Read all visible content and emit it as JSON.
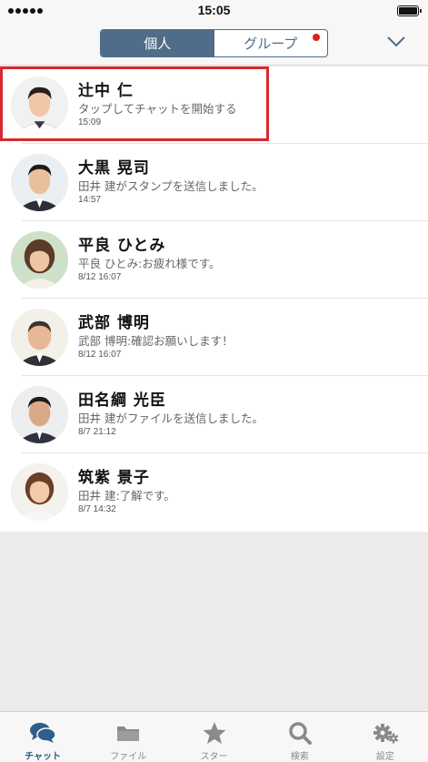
{
  "status_bar": {
    "time": "15:05",
    "battery_level": 1.0
  },
  "header": {
    "segments": [
      {
        "label": "個人",
        "active": true
      },
      {
        "label": "グループ",
        "active": false,
        "badge": true
      }
    ]
  },
  "chats": [
    {
      "name": "辻中 仁",
      "preview": "タップしてチャットを開始する",
      "time": "15:09",
      "highlighted": true
    },
    {
      "name": "大黒 晃司",
      "preview": "田井 建がスタンプを送信しました。",
      "time": "14:57"
    },
    {
      "name": "平良 ひとみ",
      "preview": "平良 ひとみ:お疲れ様です。",
      "time": "8/12 16:07"
    },
    {
      "name": "武部 博明",
      "preview": "武部 博明:確認お願いします！",
      "time": "8/12 16:07"
    },
    {
      "name": "田名綱 光臣",
      "preview": "田井 建がファイルを送信しました。",
      "time": "8/7 21:12"
    },
    {
      "name": "筑紫 景子",
      "preview": "田井 建:了解です。",
      "time": "8/7 14:32"
    }
  ],
  "tabbar": {
    "tabs": [
      {
        "label": "チャット",
        "icon": "chat-bubbles-icon",
        "active": true
      },
      {
        "label": "ファイル",
        "icon": "folder-icon",
        "active": false
      },
      {
        "label": "スター",
        "icon": "star-icon",
        "active": false
      },
      {
        "label": "検索",
        "icon": "search-icon",
        "active": false
      },
      {
        "label": "設定",
        "icon": "gear-icon",
        "active": false
      }
    ]
  },
  "colors": {
    "accent": "#4f6c88",
    "badge": "#e01e1e",
    "highlight_border": "#d9282f",
    "tab_active": "#2f5d87",
    "tab_inactive": "#8a8a8a"
  }
}
